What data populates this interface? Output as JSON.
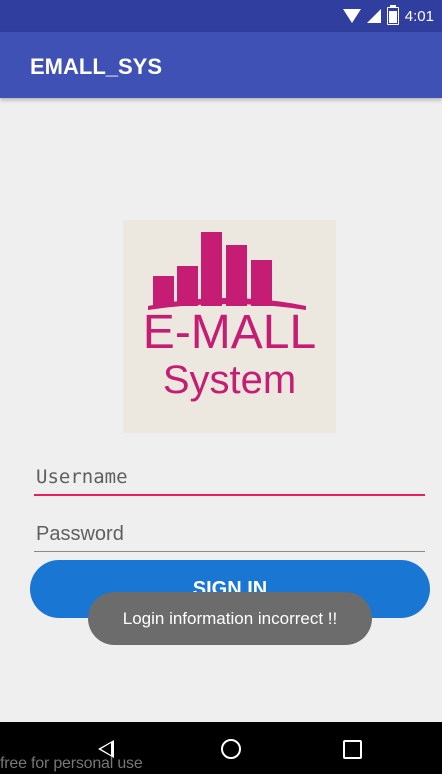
{
  "status_bar": {
    "time": "4:01",
    "icons": [
      "wifi-icon",
      "cell-signal-icon",
      "battery-icon"
    ]
  },
  "app_bar": {
    "title": "EMALL_SYS",
    "color": "#3f51b5"
  },
  "logo": {
    "main_text": "E-MALL",
    "sub_text": "System",
    "color": "#c41d73"
  },
  "form": {
    "username_placeholder": "Username",
    "username_value": "",
    "password_placeholder": "Password",
    "password_value": "",
    "sign_in_label": "SIGN IN",
    "accent_color": "#e91e63",
    "button_color": "#1976d2"
  },
  "toast": {
    "message": "Login information incorrect !!"
  },
  "navigation": {
    "back_icon": "back-icon",
    "home_icon": "home-icon",
    "recent_icon": "recent-apps-icon"
  },
  "watermark": {
    "text": "free for personal use"
  }
}
